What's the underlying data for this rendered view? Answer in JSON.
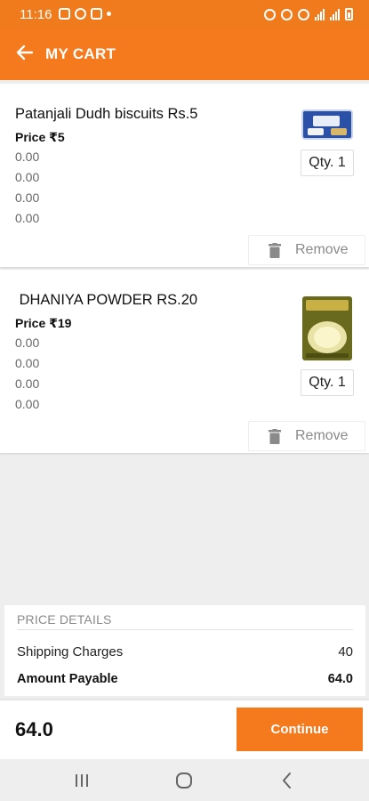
{
  "status_bar": {
    "time": "11:16",
    "dot": "•"
  },
  "app_bar": {
    "title": "MY CART",
    "back_icon": "arrow-left-icon"
  },
  "cart_items": [
    {
      "name": "Patanjali Dudh biscuits Rs.5",
      "price": "Price ₹5",
      "values": [
        "0.00",
        "0.00",
        "0.00",
        "0.00"
      ],
      "quantity": "Qty. 1",
      "remove_label": "Remove"
    },
    {
      "name": " DHANIYA POWDER RS.20",
      "price": "Price ₹19",
      "values": [
        "0.00",
        "0.00",
        "0.00",
        "0.00"
      ],
      "quantity": "Qty. 1",
      "remove_label": "Remove"
    }
  ],
  "price_details": {
    "heading": "PRICE DETAILS",
    "shipping_label": "Shipping Charges",
    "shipping_value": "40",
    "payable_label": "Amount Payable",
    "payable_value": "64.0"
  },
  "footer": {
    "total": "64.0",
    "continue_label": "Continue"
  },
  "colors": {
    "accent": "#f47a1d",
    "background": "#eeeeee"
  }
}
